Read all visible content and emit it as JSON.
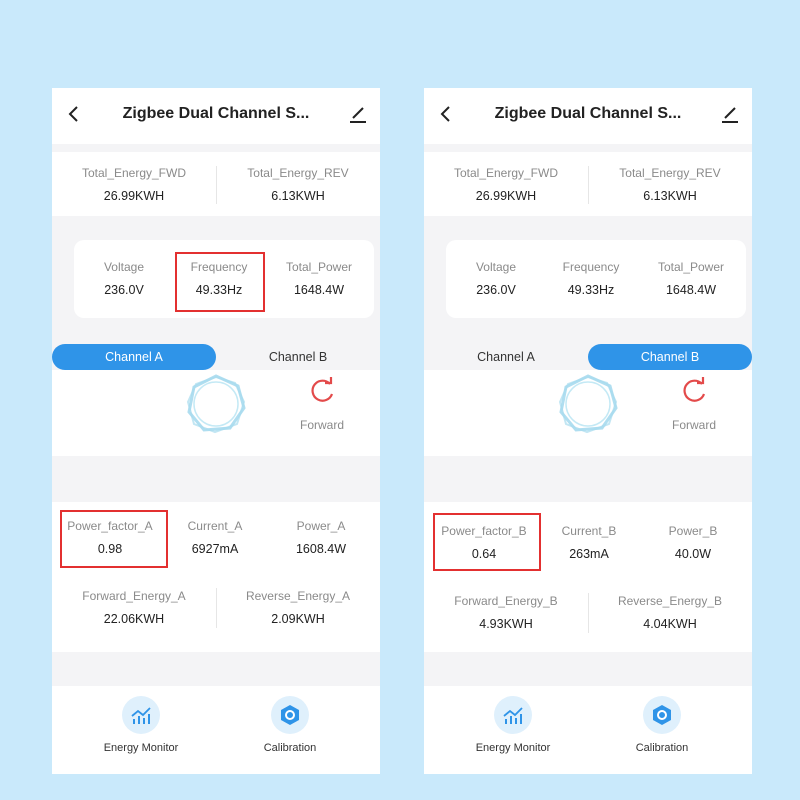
{
  "screens": [
    {
      "title": "Zigbee Dual Channel S...",
      "energy": {
        "fwd": {
          "label": "Total_Energy_FWD",
          "value": "26.99KWH"
        },
        "rev": {
          "label": "Total_Energy_REV",
          "value": "6.13KWH"
        }
      },
      "measure": {
        "voltage": {
          "label": "Voltage",
          "value": "236.0V"
        },
        "frequency": {
          "label": "Frequency",
          "value": "49.33Hz"
        },
        "total_power": {
          "label": "Total_Power",
          "value": "1648.4W"
        }
      },
      "tabs": {
        "a": "Channel A",
        "b": "Channel B",
        "active": "a"
      },
      "direction": "Forward",
      "channel": {
        "power_factor": {
          "label": "Power_factor_A",
          "value": "0.98"
        },
        "current": {
          "label": "Current_A",
          "value": "6927mA"
        },
        "power": {
          "label": "Power_A",
          "value": "1608.4W"
        },
        "forward_energy": {
          "label": "Forward_Energy_A",
          "value": "22.06KWH"
        },
        "reverse_energy": {
          "label": "Reverse_Energy_A",
          "value": "2.09KWH"
        }
      },
      "nav": {
        "energy_monitor": "Energy Monitor",
        "calibration": "Calibration"
      }
    },
    {
      "title": "Zigbee Dual Channel S...",
      "energy": {
        "fwd": {
          "label": "Total_Energy_FWD",
          "value": "26.99KWH"
        },
        "rev": {
          "label": "Total_Energy_REV",
          "value": "6.13KWH"
        }
      },
      "measure": {
        "voltage": {
          "label": "Voltage",
          "value": "236.0V"
        },
        "frequency": {
          "label": "Frequency",
          "value": "49.33Hz"
        },
        "total_power": {
          "label": "Total_Power",
          "value": "1648.4W"
        }
      },
      "tabs": {
        "a": "Channel A",
        "b": "Channel B",
        "active": "b"
      },
      "direction": "Forward",
      "channel": {
        "power_factor": {
          "label": "Power_factor_B",
          "value": "0.64"
        },
        "current": {
          "label": "Current_B",
          "value": "263mA"
        },
        "power": {
          "label": "Power_B",
          "value": "40.0W"
        },
        "forward_energy": {
          "label": "Forward_Energy_B",
          "value": "4.93KWH"
        },
        "reverse_energy": {
          "label": "Reverse_Energy_B",
          "value": "4.04KWH"
        }
      },
      "nav": {
        "energy_monitor": "Energy Monitor",
        "calibration": "Calibration"
      }
    }
  ],
  "colors": {
    "background": "#c9e9fb",
    "accent": "#2f94e8",
    "highlight": "#e33030",
    "forward_icon": "#e34a4a",
    "ring": "#8fd0ea"
  },
  "icons": {
    "back": "chevron-left-icon",
    "edit": "pencil-icon",
    "direction": "refresh-arrow-icon",
    "energy_monitor": "line-chart-icon",
    "calibration": "hexagon-gear-icon"
  }
}
